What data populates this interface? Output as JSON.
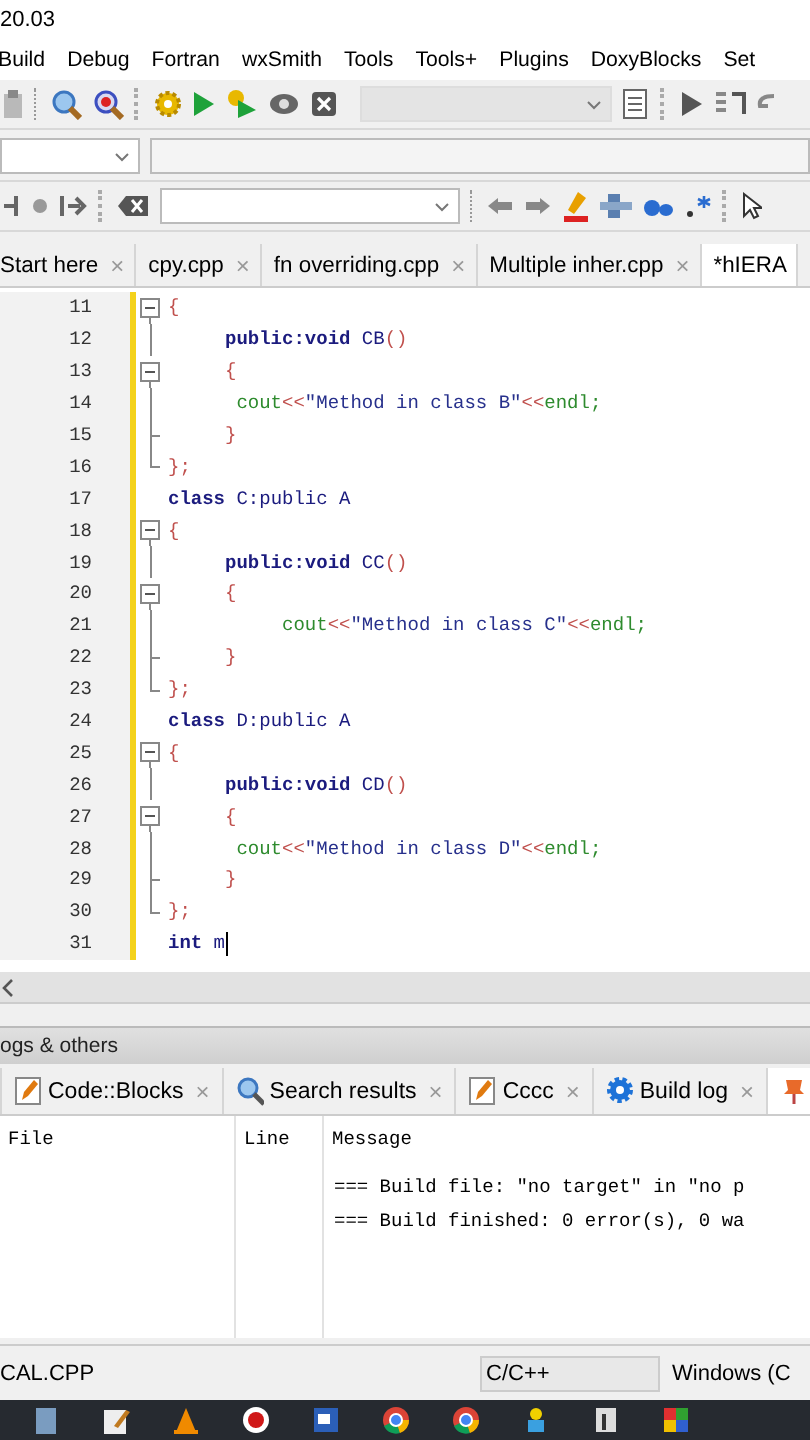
{
  "window": {
    "title": "20.03"
  },
  "menu": [
    "Build",
    "Debug",
    "Fortran",
    "wxSmith",
    "Tools",
    "Tools+",
    "Plugins",
    "DoxyBlocks",
    "Set"
  ],
  "editor_tabs": [
    {
      "label": "Start here",
      "close": "×",
      "selected": false
    },
    {
      "label": "cpy.cpp",
      "close": "×",
      "selected": false
    },
    {
      "label": "fn overriding.cpp",
      "close": "×",
      "selected": false
    },
    {
      "label": "Multiple inher.cpp",
      "close": "×",
      "selected": false
    },
    {
      "label": "*hIERA",
      "selected": true
    }
  ],
  "editor": {
    "lines": [
      {
        "number": "11",
        "kind": "fold-box",
        "tokens": [
          {
            "kind": "punct",
            "text": "{"
          }
        ]
      },
      {
        "number": "12",
        "kind": "fold-bar",
        "tokens": [
          {
            "kind": "kw",
            "text": "     public:void"
          },
          {
            "kind": "id",
            "text": " CB"
          },
          {
            "kind": "punct",
            "text": "()"
          }
        ]
      },
      {
        "number": "13",
        "kind": "fold-box",
        "tokens": [
          {
            "kind": "punct",
            "text": "     {"
          }
        ]
      },
      {
        "number": "14",
        "kind": "fold-bar",
        "tokens": [
          {
            "kind": "lib",
            "text": "      cout"
          },
          {
            "kind": "punct",
            "text": "<<"
          },
          {
            "kind": "str",
            "text": "\"Method in class B\""
          },
          {
            "kind": "punct",
            "text": "<<"
          },
          {
            "kind": "lib",
            "text": "endl;"
          }
        ]
      },
      {
        "number": "15",
        "kind": "fold-tee",
        "tokens": [
          {
            "kind": "punct",
            "text": "     }"
          }
        ]
      },
      {
        "number": "16",
        "kind": "fold-end",
        "tokens": [
          {
            "kind": "punct",
            "text": "};"
          }
        ]
      },
      {
        "number": "17",
        "kind": "plain",
        "tokens": [
          {
            "kind": "kw",
            "text": "class"
          },
          {
            "kind": "id",
            "text": " C:public A"
          }
        ]
      },
      {
        "number": "18",
        "kind": "fold-box",
        "tokens": [
          {
            "kind": "punct",
            "text": "{"
          }
        ]
      },
      {
        "number": "19",
        "kind": "fold-bar",
        "tokens": [
          {
            "kind": "kw",
            "text": "     public:void"
          },
          {
            "kind": "id",
            "text": " CC"
          },
          {
            "kind": "punct",
            "text": "()"
          }
        ]
      },
      {
        "number": "20",
        "kind": "fold-box",
        "tokens": [
          {
            "kind": "punct",
            "text": "     {"
          }
        ]
      },
      {
        "number": "21",
        "kind": "fold-bar",
        "tokens": [
          {
            "kind": "lib",
            "text": "          cout"
          },
          {
            "kind": "punct",
            "text": "<<"
          },
          {
            "kind": "str",
            "text": "\"Method in class C\""
          },
          {
            "kind": "punct",
            "text": "<<"
          },
          {
            "kind": "lib",
            "text": "endl;"
          }
        ]
      },
      {
        "number": "22",
        "kind": "fold-tee",
        "tokens": [
          {
            "kind": "punct",
            "text": "     }"
          }
        ]
      },
      {
        "number": "23",
        "kind": "fold-end",
        "tokens": [
          {
            "kind": "punct",
            "text": "};"
          }
        ]
      },
      {
        "number": "24",
        "kind": "plain",
        "tokens": [
          {
            "kind": "kw",
            "text": "class"
          },
          {
            "kind": "id",
            "text": " D:public A"
          }
        ]
      },
      {
        "number": "25",
        "kind": "fold-box",
        "tokens": [
          {
            "kind": "punct",
            "text": "{"
          }
        ]
      },
      {
        "number": "26",
        "kind": "fold-bar",
        "tokens": [
          {
            "kind": "kw",
            "text": "     public:void"
          },
          {
            "kind": "id",
            "text": " CD"
          },
          {
            "kind": "punct",
            "text": "()"
          }
        ]
      },
      {
        "number": "27",
        "kind": "fold-box",
        "tokens": [
          {
            "kind": "punct",
            "text": "     {"
          }
        ]
      },
      {
        "number": "28",
        "kind": "fold-bar",
        "tokens": [
          {
            "kind": "lib",
            "text": "      cout"
          },
          {
            "kind": "punct",
            "text": "<<"
          },
          {
            "kind": "str",
            "text": "\"Method in class D\""
          },
          {
            "kind": "punct",
            "text": "<<"
          },
          {
            "kind": "lib",
            "text": "endl;"
          }
        ]
      },
      {
        "number": "29",
        "kind": "fold-tee",
        "tokens": [
          {
            "kind": "punct",
            "text": "     }"
          }
        ]
      },
      {
        "number": "30",
        "kind": "fold-end",
        "tokens": [
          {
            "kind": "punct",
            "text": "};"
          }
        ]
      },
      {
        "number": "31",
        "kind": "plain",
        "tokens": [
          {
            "kind": "kw",
            "text": "int"
          },
          {
            "kind": "id",
            "text": " m"
          }
        ],
        "cursor": true
      }
    ]
  },
  "logs_panel": {
    "title": "ogs & others",
    "tabs": [
      {
        "kind": "pencil",
        "label": "Code::Blocks",
        "close": "×",
        "selected": false
      },
      {
        "kind": "search",
        "label": "Search results",
        "close": "×",
        "selected": false
      },
      {
        "kind": "pencil",
        "label": "Cccc",
        "close": "×",
        "selected": false
      },
      {
        "kind": "gear",
        "label": "Build log",
        "close": "×",
        "selected": false
      },
      {
        "kind": "pin",
        "selected": true
      }
    ],
    "table": {
      "columns": [
        "File",
        "Line",
        "Message"
      ],
      "rows": [
        {
          "message": "=== Build file: \"no target\" in \"no p"
        },
        {
          "message": "=== Build finished: 0 error(s), 0 wa"
        }
      ]
    }
  },
  "status_bar": [
    "CAL.CPP",
    "C/C++",
    "Windows (C"
  ]
}
